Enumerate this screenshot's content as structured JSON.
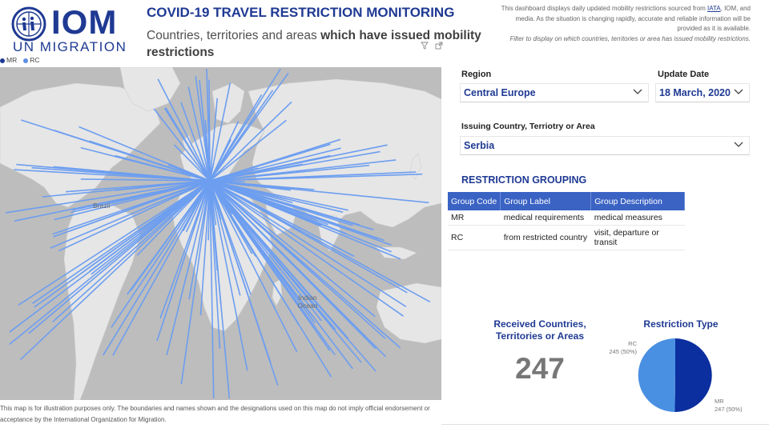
{
  "header": {
    "logo_text": "IOM",
    "logo_subtext": "UN MIGRATION",
    "title": "COVID-19 TRAVEL RESTRICTION MONITORING",
    "subtitle_plain": "Countries, territories and areas ",
    "subtitle_bold": "which have issued mobility restrictions",
    "info_text_1": "This dashboard displays daily updated mobility restrictions sourced from ",
    "info_link": "IATA",
    "info_text_2": ", IOM, and media. As the situation is changing rapidly, accurate and reliable information will be provided as it is available.",
    "info_note": "Filter to display on which countries, territories or area has issued mobility restrictions."
  },
  "map": {
    "legend": [
      {
        "label": "MR",
        "color": "#1f3a93"
      },
      {
        "label": "RC",
        "color": "#5b8ee6"
      }
    ],
    "line_color": "#6d9ef0",
    "land_color": "#e6e6e6",
    "water_color": "#bdbdbd",
    "labels": {
      "brazil": "Brazil",
      "indian_ocean": "Indian Ocean"
    },
    "footer": "This map is for illustration purposes only. The boundaries and names shown and the designations used on this map do not imply official endorsement or acceptance by the International Organization for Migration."
  },
  "filters": {
    "region_label": "Region",
    "region_value": "Central Europe",
    "date_label": "Update Date",
    "date_value": "18 March, 2020",
    "country_label": "Issuing Country, Terriotry or Area",
    "country_value": "Serbia"
  },
  "grouping": {
    "title": "RESTRICTION GROUPING",
    "headers": [
      "Group Code",
      "Group Label",
      "Group Description"
    ],
    "rows": [
      [
        "MR",
        "medical requirements",
        "medical measures"
      ],
      [
        "RC",
        "from restricted country",
        "visit, departure or transit"
      ]
    ]
  },
  "kpi": {
    "title": "Received Countries, Territories or Areas",
    "value": "247"
  },
  "chart_data": {
    "type": "pie",
    "title": "Restriction Type",
    "slices": [
      {
        "label": "MR",
        "value": 247,
        "percent": "50%",
        "color": "#0b2f9e"
      },
      {
        "label": "RC",
        "value": 245,
        "percent": "50%",
        "color": "#4a90e2"
      }
    ],
    "slice_labels": [
      "247 (50%)",
      "245 (50%)"
    ]
  }
}
